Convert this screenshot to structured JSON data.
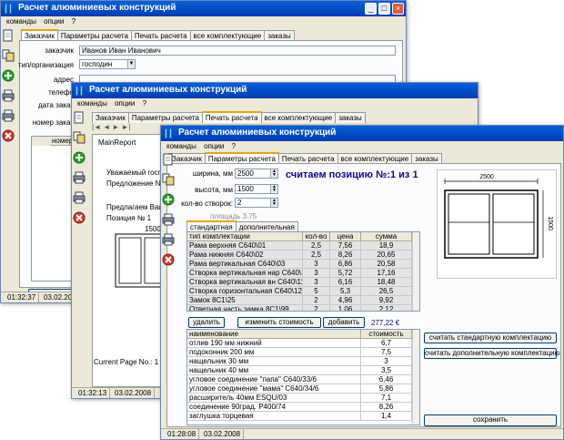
{
  "app_title": "Расчет алюминиевых конструкций",
  "menu": [
    "команды",
    "опции",
    "?"
  ],
  "tabs": [
    "Заказчик",
    "Параметры расчета",
    "Печать расчета",
    "все комплектующие",
    "заказы"
  ],
  "icons": [
    "document-icon",
    "copy-icon",
    "add-icon",
    "print-icon",
    "print-icon",
    "delete-icon"
  ],
  "win1": {
    "active_tab": "Заказчик",
    "form": {
      "customer_label": "заказчик",
      "customer_value": "Иванов Иван Иванович",
      "type_label": "тип/организация",
      "type_value": "господин",
      "address_label": "адрес",
      "phone_label": "телефо",
      "order_date_label": "дата заказ",
      "order_number_label": "номер заказ"
    },
    "table_col": "номер",
    "status": {
      "time": "01:32:37",
      "date": "03.02.2008"
    }
  },
  "win2": {
    "active_tab": "Печать расчета",
    "report_name": "MainReport",
    "report_text": [
      "Уважаемый госп",
      "Предложение N",
      "Предлагаем Ваш",
      "Позиция № 1"
    ],
    "dim_label": "1500",
    "page_text": "Current Page No.: 1",
    "status": {
      "time": "01:32:13",
      "date": "03.02.2008"
    }
  },
  "win3": {
    "active_tab": "Параметры расчета",
    "fields": {
      "width_label": "ширина, мм",
      "width_value": "2500",
      "height_label": "высота, мм",
      "height_value": "1500",
      "sashes_label": "кол-во створок:",
      "sashes_value": "2",
      "area_label": "площадь 3.75"
    },
    "heading": "считаем позицию №:1 из 1",
    "sub_tabs": [
      "стандартная",
      "дополнительная"
    ],
    "table1": {
      "headers": [
        "тип комплектации",
        "кол-во",
        "цена",
        "сумма"
      ],
      "rows": [
        [
          "Рама верхняя С640\\01",
          "2,5",
          "7,56",
          "18,9"
        ],
        [
          "Рама нижняя С640\\02",
          "2,5",
          "8,26",
          "20,65"
        ],
        [
          "Рама вертикальная С640\\03",
          "3",
          "6,86",
          "20,58"
        ],
        [
          "Створка вертикальная нар С640\\10",
          "3",
          "5,72",
          "17,16"
        ],
        [
          "Створка вертикальная вн С640\\11",
          "3",
          "6,16",
          "18,48"
        ],
        [
          "Створка горизонтальная С640\\12",
          "5",
          "5,3",
          "26,5"
        ],
        [
          "Замок 8С1\\25",
          "2",
          "4,96",
          "9,92"
        ],
        [
          "Ответная часть замка 8С1\\99",
          "2",
          "1,06",
          "2,12"
        ]
      ]
    },
    "buttons": {
      "delete": "удалить",
      "change_price": "изменить стоимость",
      "add": "добавить",
      "std_kit": "считать стандартную комплектацию",
      "extra_kit": "считать дополнительную комплектацию",
      "save": "сохранить"
    },
    "total": "277,22 €",
    "table2": {
      "headers": [
        "наименование",
        "стоимость"
      ],
      "rows": [
        [
          "отлив 190 мм нижний",
          "6,7"
        ],
        [
          "подоконник 200 мм",
          "7,5"
        ],
        [
          "нащельник 30 мм",
          "3"
        ],
        [
          "нащельник 40 мм",
          "3,5"
        ],
        [
          "угловое соединение \"папа\" С640/33/6",
          "6,46"
        ],
        [
          "угловое соединение \"мама\" С640/34/6",
          "5,86"
        ],
        [
          "расширитель 40мм ESQU/03",
          "7,1"
        ],
        [
          "соединение 90град. Р400/74",
          "8,26"
        ],
        [
          "заглушка  торцевая",
          "1,4"
        ]
      ]
    },
    "drawing": {
      "width_label": "2500",
      "height_label": "1500"
    },
    "status": {
      "time": "01:28:08",
      "date": "03.02.2008"
    }
  }
}
